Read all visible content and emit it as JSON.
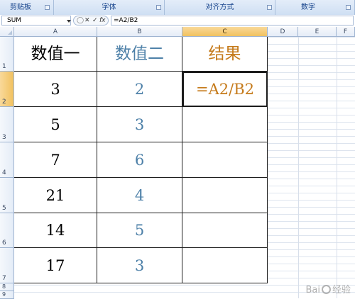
{
  "ribbon": {
    "groups": [
      "剪贴板",
      "字体",
      "对齐方式",
      "数字"
    ]
  },
  "formula_bar": {
    "name_box": "SUM",
    "cancel_symbol": "✕",
    "enter_symbol": "✓",
    "fx_label": "fx",
    "formula": "=A2/B2"
  },
  "columns": [
    "A",
    "B",
    "C",
    "D",
    "E",
    "F"
  ],
  "rows": [
    "1",
    "2",
    "3",
    "4",
    "5",
    "6",
    "7",
    "8",
    "9"
  ],
  "table": {
    "headers": [
      "数值一",
      "数值二",
      "结果"
    ],
    "values_a": [
      "3",
      "5",
      "7",
      "21",
      "14",
      "17"
    ],
    "values_b": [
      "2",
      "3",
      "6",
      "4",
      "5",
      "3"
    ],
    "result_c2": "=A2/B2"
  },
  "selection": {
    "active_cell": "C2"
  },
  "colors": {
    "col_a": "#000000",
    "col_b": "#4d80a8",
    "col_c": "#c57a1a",
    "selected_header": "#f1c15f"
  },
  "watermark": {
    "text_left": "Bai",
    "text_right": "经验"
  }
}
